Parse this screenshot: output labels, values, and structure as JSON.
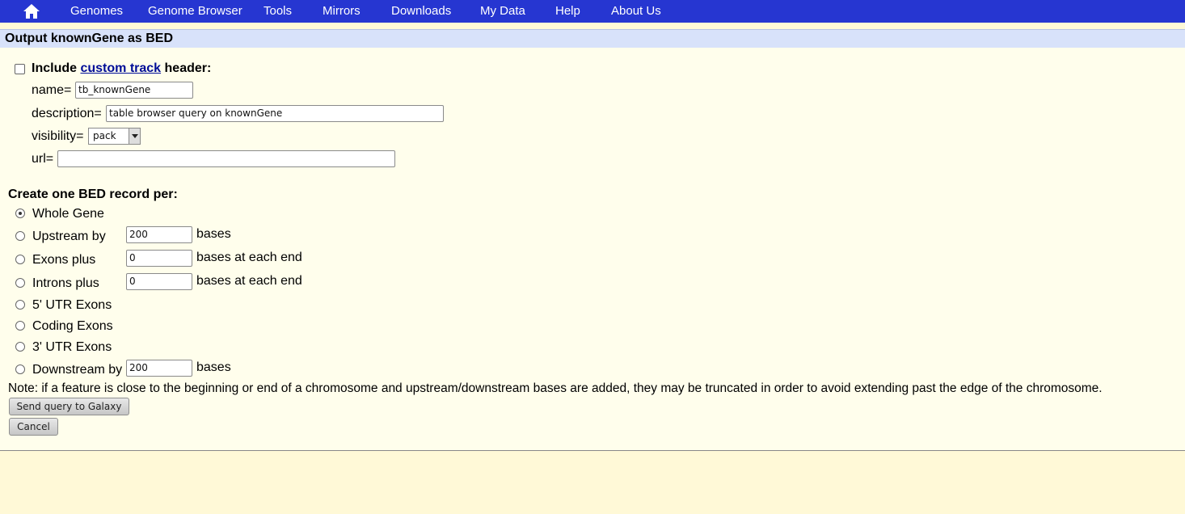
{
  "nav": {
    "items": [
      "Genomes",
      "Genome Browser",
      "Tools",
      "Mirrors",
      "Downloads",
      "My Data",
      "Help",
      "About Us"
    ]
  },
  "page": {
    "title": "Output knownGene as BED"
  },
  "header_opt": {
    "include_prefix": "Include",
    "custom_track_link": "custom track",
    "include_suffix": "header:",
    "checked": false,
    "name_label": "name=",
    "name_value": "tb_knownGene",
    "description_label": "description=",
    "description_value": "table browser query on knownGene",
    "visibility_label": "visibility=",
    "visibility_value": "pack",
    "url_label": "url=",
    "url_value": ""
  },
  "bed": {
    "heading": "Create one BED record per:",
    "options": {
      "whole_gene": "Whole Gene",
      "upstream": "Upstream by",
      "exons_plus": "Exons plus",
      "introns_plus": "Introns plus",
      "utr5": "5' UTR Exons",
      "coding": "Coding Exons",
      "utr3": "3' UTR Exons",
      "downstream": "Downstream by"
    },
    "selected": "whole_gene",
    "upstream_value": "200",
    "exons_value": "0",
    "introns_value": "0",
    "downstream_value": "200",
    "bases": "bases",
    "bases_each_end": "bases at each end"
  },
  "note": "Note: if a feature is close to the beginning or end of a chromosome and upstream/downstream bases are added, they may be truncated in order to avoid extending past the edge of the chromosome.",
  "buttons": {
    "send": "Send query to Galaxy",
    "cancel": "Cancel"
  },
  "colors": {
    "nav_bg": "#2636d1",
    "page_bg": "#fff9d7",
    "title_bg": "#d8e2fa",
    "link": "#000d97"
  }
}
